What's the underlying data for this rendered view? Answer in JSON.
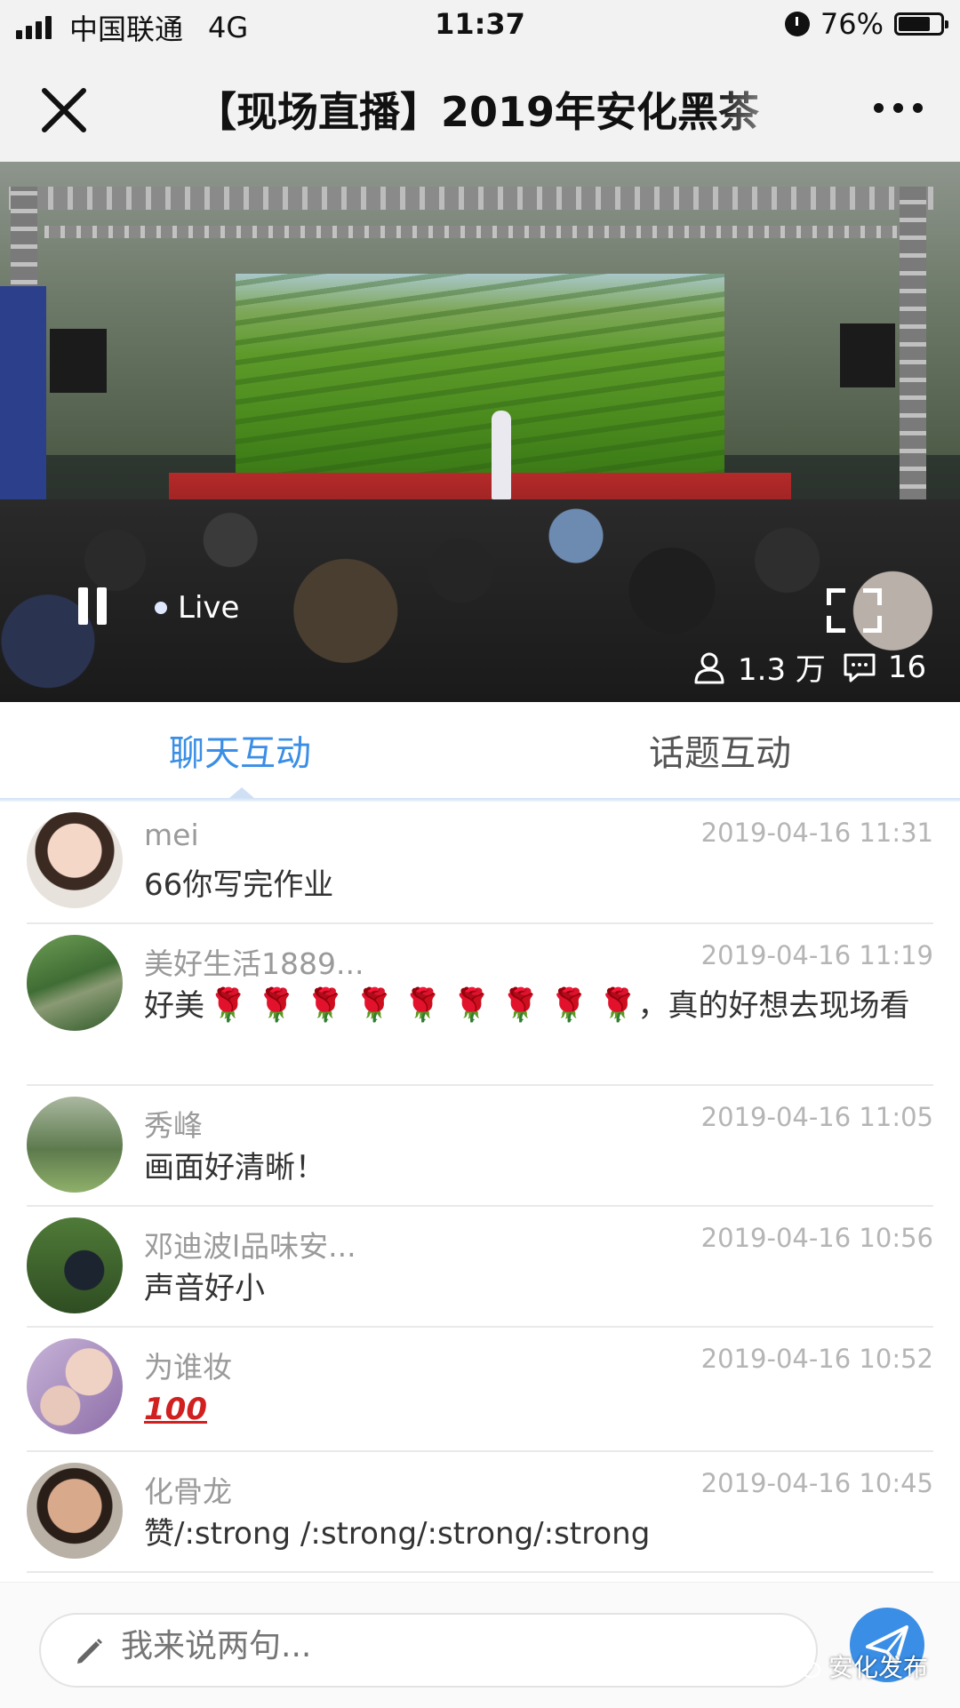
{
  "status_bar": {
    "carrier": "中国联通",
    "network": "4G",
    "time": "11:37",
    "battery": "76%",
    "battery_level": 0.76,
    "icons": [
      "signal-icon",
      "alarm-icon",
      "battery-icon"
    ]
  },
  "nav": {
    "title": "【现场直播】2019年安化黑茶",
    "icons": [
      "close-icon",
      "more-icon"
    ]
  },
  "video": {
    "live_label": "Live",
    "viewers": "1.3 万",
    "comments": "16",
    "icons": [
      "pause-icon",
      "fullscreen-icon",
      "viewer-icon",
      "comment-icon"
    ]
  },
  "tabs": [
    {
      "label": "聊天互动",
      "active": true
    },
    {
      "label": "话题互动",
      "active": false
    }
  ],
  "messages": [
    {
      "name": "mei",
      "time": "2019-04-16 11:31",
      "text": "66你写完作业"
    },
    {
      "name": "美好生活1889...",
      "time": "2019-04-16 11:19",
      "text_prefix": "好美",
      "roses": [
        "🌹",
        "🌹",
        "🌹",
        "🌹",
        "🌹",
        "🌹",
        "🌹",
        "🌹",
        "🌹"
      ],
      "text_suffix": "，真的好想去现场看"
    },
    {
      "name": "秀峰",
      "time": "2019-04-16 11:05",
      "text": "画面好清晰！"
    },
    {
      "name": "邓迪波l品味安...",
      "time": "2019-04-16 10:56",
      "text": "声音好小"
    },
    {
      "name": "为谁妆",
      "time": "2019-04-16 10:52",
      "text": "100"
    },
    {
      "name": "化骨龙",
      "time": "2019-04-16 10:45",
      "text": "赞/:strong /:strong/:strong/:strong"
    }
  ],
  "input": {
    "placeholder": "我来说两句..."
  },
  "watermark": "安化发布",
  "colors": {
    "accent": "#3a8ee6",
    "rose": "#c8102e"
  }
}
